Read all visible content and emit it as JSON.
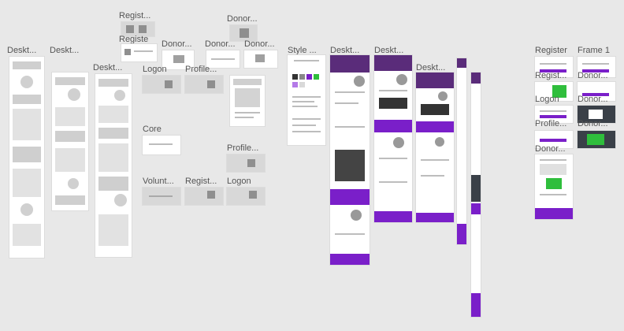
{
  "canvas": {
    "background": "#e8e8e8"
  },
  "labels": {
    "desktop_1": "Deskt...",
    "desktop_2": "Deskt...",
    "desktop_3": "Deskt...",
    "register_1": "Regist...",
    "register_2": "Registe",
    "donor_1": "Donor...",
    "donor_2": "Donor...",
    "donor_3": "Donor...",
    "donor_4": "Donor...",
    "logon_1": "Logon",
    "profile_1": "Profile...",
    "core": "Core",
    "volunteer": "Volunt...",
    "register_3": "Regist...",
    "logon_2": "Logon",
    "profile_2": "Profile...",
    "style": "Style ...",
    "desktop_4": "Deskt...",
    "desktop_5": "Deskt...",
    "desktop_6": "Deskt...",
    "register_4": "Register",
    "frame_1": "Frame 1",
    "register_5": "Regist...",
    "donor_5": "Donor...",
    "logon_3": "Logon",
    "donor_6": "Donor...",
    "profile_3": "Profile...",
    "donor_7": "Donor...",
    "donor_8": "Donor..."
  },
  "colors": {
    "accent": "#7a1fc9",
    "success": "#2fbe3c",
    "dark": "#3a4048"
  }
}
